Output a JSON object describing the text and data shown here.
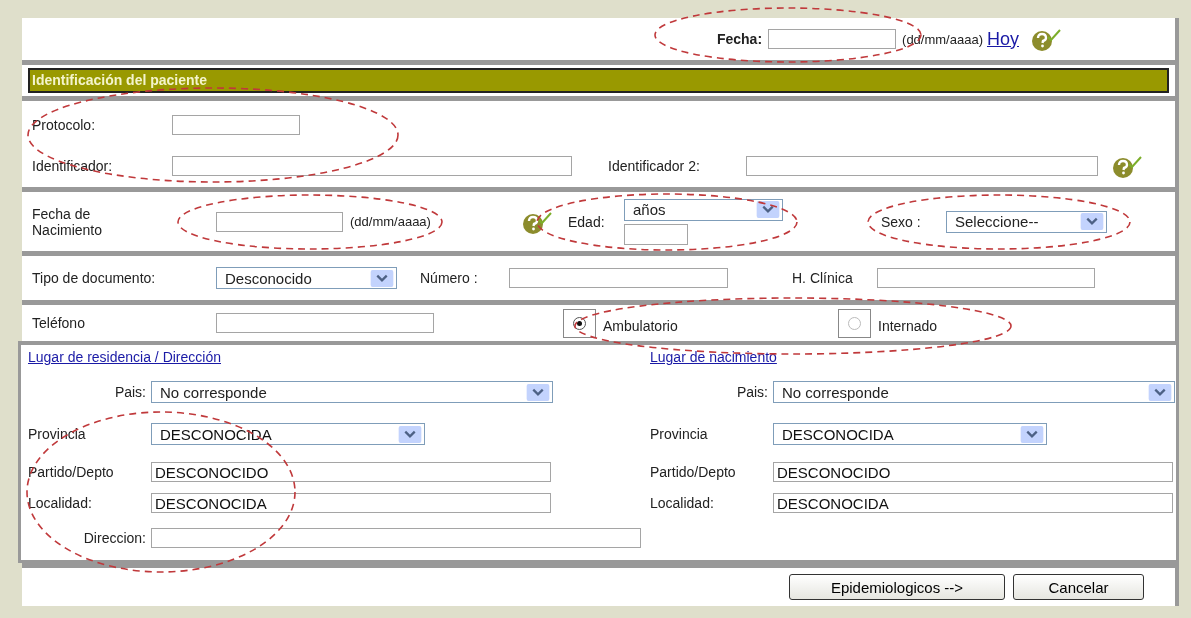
{
  "date_row": {
    "label": "Fecha:",
    "format": "(dd/mm/aaaa)",
    "today_link": "Hoy"
  },
  "section_title": "Identificación del paciente",
  "protocol": {
    "label": "Protocolo:"
  },
  "identifier": {
    "label": "Identificador:"
  },
  "identifier_2": {
    "label": "Identificador 2:"
  },
  "birth": {
    "label": "Fecha de Nacimiento",
    "format": "(dd/mm/aaaa)"
  },
  "age": {
    "label": "Edad:",
    "unit": "años"
  },
  "sex": {
    "label": "Sexo :",
    "value": "Seleccione--"
  },
  "document": {
    "label": "Tipo de documento:",
    "value": "Desconocido",
    "number_label": "Número :",
    "record_label": "H. Clínica"
  },
  "phone": {
    "label": "Teléfono"
  },
  "care_type": [
    {
      "label": "Ambulatorio",
      "selected": true
    },
    {
      "label": "Internado",
      "selected": false
    }
  ],
  "places": [
    {
      "title": "Lugar de residencia / Dirección",
      "country_label": "Pais:",
      "country": "No corresponde",
      "province_label": "Provincia",
      "province": "DESCONOCIDA",
      "district_label": "Partido/Depto",
      "district": "DESCONOCIDO",
      "locality_label": "Localidad:",
      "locality": "DESCONOCIDA",
      "address_label": "Direccion:"
    },
    {
      "title": "Lugar de nacimiento",
      "country_label": "Pais:",
      "country": "No corresponde",
      "province_label": "Provincia",
      "province": "DESCONOCIDA",
      "district_label": "Partido/Depto",
      "district": "DESCONOCIDO",
      "locality_label": "Localidad:",
      "locality": "DESCONOCIDA"
    }
  ],
  "buttons": [
    {
      "label": "Epidemiologicos -->"
    },
    {
      "label": "Cancelar"
    }
  ]
}
